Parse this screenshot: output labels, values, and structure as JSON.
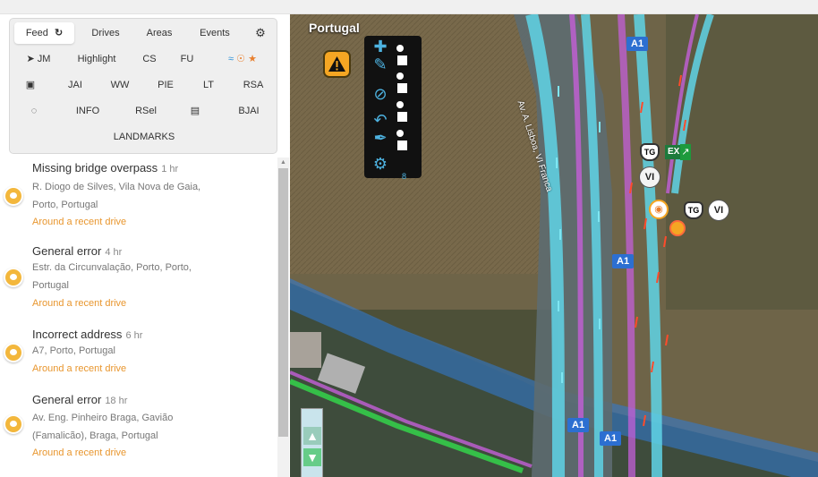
{
  "menu": {
    "row1": [
      {
        "label": "Feed",
        "icon": "refresh-icon",
        "active": true
      },
      {
        "label": "Drives"
      },
      {
        "label": "Areas"
      },
      {
        "label": "Events"
      },
      {
        "label": "",
        "icon": "gear-icon"
      }
    ],
    "row2": [
      {
        "label": "JM",
        "icon": "send-icon"
      },
      {
        "label": "Highlight"
      },
      {
        "label": "CS"
      },
      {
        "label": "FU"
      },
      {
        "label": "",
        "icon": "activity-icons"
      }
    ],
    "row3": [
      {
        "label": "",
        "icon": "image-icon"
      },
      {
        "label": "JAI"
      },
      {
        "label": "WW"
      },
      {
        "label": "PIE"
      },
      {
        "label": "LT"
      },
      {
        "label": "RSA"
      }
    ],
    "row4": [
      {
        "label": "",
        "icon": "lasso-icon"
      },
      {
        "label": "INFO"
      },
      {
        "label": "RSel"
      },
      {
        "label": "",
        "icon": "briefcase-icon"
      },
      {
        "label": "BJAI"
      }
    ],
    "row5": [
      {
        "label": "LANDMARKS"
      }
    ]
  },
  "feed": [
    {
      "title": "Missing bridge overpass",
      "time": "1 hr",
      "address_lines": [
        "R. Diogo de Silves, Vila Nova de Gaia,",
        "Porto, Portugal"
      ],
      "link": "Around a recent drive"
    },
    {
      "title": "General error",
      "time": "4 hr",
      "address_lines": [
        "Estr. da Circunvalação, Porto, Porto,",
        "Portugal"
      ],
      "link": "Around a recent drive"
    },
    {
      "title": "Incorrect address",
      "time": "6 hr",
      "address_lines": [
        "A7, Porto, Portugal"
      ],
      "link": "Around a recent drive"
    },
    {
      "title": "General error",
      "time": "18 hr",
      "address_lines": [
        "Av. Eng. Pinheiro Braga, Gavião",
        "(Famalicão), Braga, Portugal"
      ],
      "link": "Around a recent drive"
    }
  ],
  "map": {
    "title": "Portugal",
    "road_shields": [
      "A1",
      "A1",
      "A1",
      "A1"
    ],
    "street_label": "Av. A. Lisboa, VI Franca",
    "badges": {
      "tg1": "TG",
      "ex": "EX",
      "vi1": "VI",
      "tg2": "TG",
      "vi2": "VI"
    },
    "toolbox_number": "8",
    "colors": {
      "highway": "#5fd3e6",
      "route_purple": "#c45fd8",
      "arrow_red": "#ff4b2b",
      "arrow_green": "#34d34a",
      "water_blue": "#2f7bd9",
      "warning": "#f5a623"
    }
  }
}
